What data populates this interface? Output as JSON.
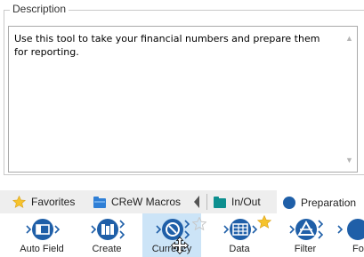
{
  "description": {
    "legend": "Description",
    "text": "Use this tool to take your financial numbers and prepare them for reporting."
  },
  "palette": {
    "tabs": [
      {
        "label": "Favorites",
        "icon": "star-icon"
      },
      {
        "label": "CReW Macros",
        "icon": "folder-icon"
      },
      {
        "label": "In/Out",
        "icon": "folder-icon"
      },
      {
        "label": "Preparation",
        "icon": "circle-icon",
        "selected": true
      }
    ],
    "tools": [
      {
        "label": "Auto Field",
        "icon": "auto-field-icon"
      },
      {
        "label": "Create",
        "icon": "create-samples-icon"
      },
      {
        "label": "Currency",
        "icon": "currency-icon",
        "selected": true,
        "favorite": false
      },
      {
        "label": "Data",
        "icon": "data-cleansing-icon",
        "favorite": true
      },
      {
        "label": "Filter",
        "icon": "filter-icon"
      },
      {
        "label": "Fo",
        "icon": "formula-icon"
      }
    ]
  },
  "colors": {
    "tool_blue": "#1f5fa8",
    "star_yellow": "#f6c32c",
    "selected_bg": "#cce4f7",
    "tabbar_bg": "#eeeeee",
    "crew_blue": "#2f7fd6",
    "inout_teal": "#0d8f8f"
  }
}
